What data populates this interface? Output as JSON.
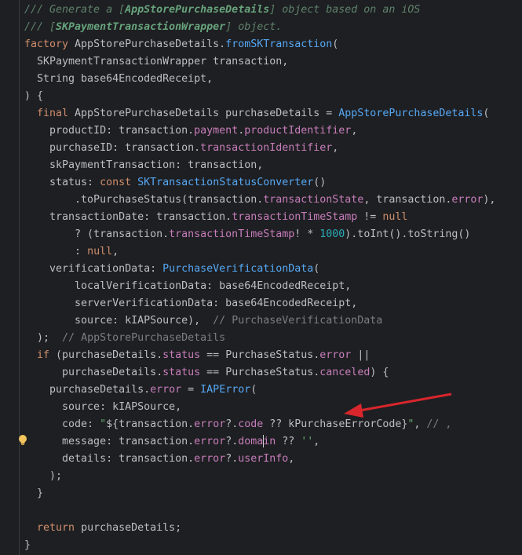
{
  "editor": {
    "lines": [
      [
        [
          "doc",
          "/// Generate a ["
        ],
        [
          "docref",
          "AppStorePurchaseDetails"
        ],
        [
          "doc",
          "] object based on an iOS"
        ]
      ],
      [
        [
          "doc",
          "/// ["
        ],
        [
          "docref",
          "SKPaymentTransactionWrapper"
        ],
        [
          "doc",
          "] object."
        ]
      ],
      [
        [
          "kw",
          "factory "
        ],
        [
          "txt",
          "AppStorePurchaseDetails."
        ],
        [
          "fn",
          "fromSKTransaction"
        ],
        [
          "txt",
          "("
        ]
      ],
      [
        [
          "txt",
          "  SKPaymentTransactionWrapper transaction,"
        ]
      ],
      [
        [
          "txt",
          "  String base64EncodedReceipt,"
        ]
      ],
      [
        [
          "txt",
          ") {"
        ]
      ],
      [
        [
          "kw",
          "  final "
        ],
        [
          "txt",
          "AppStorePurchaseDetails purchaseDetails = "
        ],
        [
          "fn",
          "AppStorePurchaseDetails"
        ],
        [
          "txt",
          "("
        ]
      ],
      [
        [
          "txt",
          "    productID: transaction."
        ],
        [
          "fld",
          "payment"
        ],
        [
          "txt",
          "."
        ],
        [
          "fld",
          "productIdentifier"
        ],
        [
          "txt",
          ","
        ]
      ],
      [
        [
          "txt",
          "    purchaseID: transaction."
        ],
        [
          "fld",
          "transactionIdentifier"
        ],
        [
          "txt",
          ","
        ]
      ],
      [
        [
          "txt",
          "    skPaymentTransaction: transaction,"
        ]
      ],
      [
        [
          "txt",
          "    status: "
        ],
        [
          "kw",
          "const "
        ],
        [
          "fn",
          "SKTransactionStatusConverter"
        ],
        [
          "txt",
          "()"
        ]
      ],
      [
        [
          "txt",
          "        .toPurchaseStatus(transaction."
        ],
        [
          "fld",
          "transactionState"
        ],
        [
          "txt",
          ", transaction."
        ],
        [
          "fld",
          "error"
        ],
        [
          "txt",
          "),"
        ]
      ],
      [
        [
          "txt",
          "    transactionDate: transaction."
        ],
        [
          "fld",
          "transactionTimeStamp"
        ],
        [
          "txt",
          " != "
        ],
        [
          "kw",
          "null"
        ]
      ],
      [
        [
          "txt",
          "        ? (transaction."
        ],
        [
          "fld",
          "transactionTimeStamp"
        ],
        [
          "txt",
          "! * "
        ],
        [
          "num",
          "1000"
        ],
        [
          "txt",
          ").toInt().toString()"
        ]
      ],
      [
        [
          "txt",
          "        : "
        ],
        [
          "kw",
          "null"
        ],
        [
          "txt",
          ","
        ]
      ],
      [
        [
          "txt",
          "    verificationData: "
        ],
        [
          "fn",
          "PurchaseVerificationData"
        ],
        [
          "txt",
          "("
        ]
      ],
      [
        [
          "txt",
          "        localVerificationData: base64EncodedReceipt,"
        ]
      ],
      [
        [
          "txt",
          "        serverVerificationData: base64EncodedReceipt,"
        ]
      ],
      [
        [
          "txt",
          "        source: kIAPSource),  "
        ],
        [
          "cm",
          "// PurchaseVerificationData"
        ]
      ],
      [
        [
          "txt",
          "  );  "
        ],
        [
          "cm",
          "// AppStorePurchaseDetails"
        ]
      ],
      [
        [
          "kw",
          "  if "
        ],
        [
          "txt",
          "(purchaseDetails."
        ],
        [
          "fld",
          "status"
        ],
        [
          "txt",
          " == PurchaseStatus."
        ],
        [
          "fld",
          "error"
        ],
        [
          "txt",
          " ||"
        ]
      ],
      [
        [
          "txt",
          "      purchaseDetails."
        ],
        [
          "fld",
          "status"
        ],
        [
          "txt",
          " == PurchaseStatus."
        ],
        [
          "fld",
          "canceled"
        ],
        [
          "txt",
          ") {"
        ]
      ],
      [
        [
          "txt",
          "    purchaseDetails."
        ],
        [
          "fld",
          "error"
        ],
        [
          "txt",
          " = "
        ],
        [
          "fn",
          "IAPError"
        ],
        [
          "txt",
          "("
        ]
      ],
      [
        [
          "txt",
          "      source: kIAPSource,"
        ]
      ],
      [
        [
          "txt",
          "      code: "
        ],
        [
          "str",
          "\""
        ],
        [
          "txt",
          "${transaction."
        ],
        [
          "fld",
          "error"
        ],
        [
          "txt",
          "?."
        ],
        [
          "fld",
          "code"
        ],
        [
          "txt",
          " ?? kPurchaseErrorCode}"
        ],
        [
          "str",
          "\""
        ],
        [
          "txt",
          ", "
        ],
        [
          "cm",
          "// ,"
        ]
      ],
      [
        [
          "txt",
          "      message: transaction."
        ],
        [
          "fld",
          "error"
        ],
        [
          "txt",
          "?."
        ],
        [
          "fld",
          "doma"
        ],
        [
          "caret",
          ""
        ],
        [
          "fld",
          "in"
        ],
        [
          "txt",
          " ?? "
        ],
        [
          "str",
          "''"
        ],
        [
          "txt",
          ","
        ]
      ],
      [
        [
          "txt",
          "      details: transaction."
        ],
        [
          "fld",
          "error"
        ],
        [
          "txt",
          "?."
        ],
        [
          "fld",
          "userInfo"
        ],
        [
          "txt",
          ","
        ]
      ],
      [
        [
          "txt",
          "    );"
        ]
      ],
      [
        [
          "txt",
          "  }"
        ]
      ],
      [
        [
          "txt",
          ""
        ]
      ],
      [
        [
          "kw",
          "  return "
        ],
        [
          "txt",
          "purchaseDetails;"
        ]
      ],
      [
        [
          "txt",
          "}"
        ]
      ]
    ]
  },
  "colors": {
    "background": "#1e1f22",
    "text": "#bcbec4",
    "keyword": "#cf8e6d",
    "function": "#56a8f5",
    "field": "#c77dbb",
    "string": "#6aab73",
    "number": "#2aacb8",
    "comment": "#7a7e85",
    "doc_comment": "#5f826b",
    "annotation_arrow": "#d9262c"
  },
  "icons": {
    "gutter_bulb": "lightbulb-icon",
    "annotation": "red-arrow-icon"
  }
}
